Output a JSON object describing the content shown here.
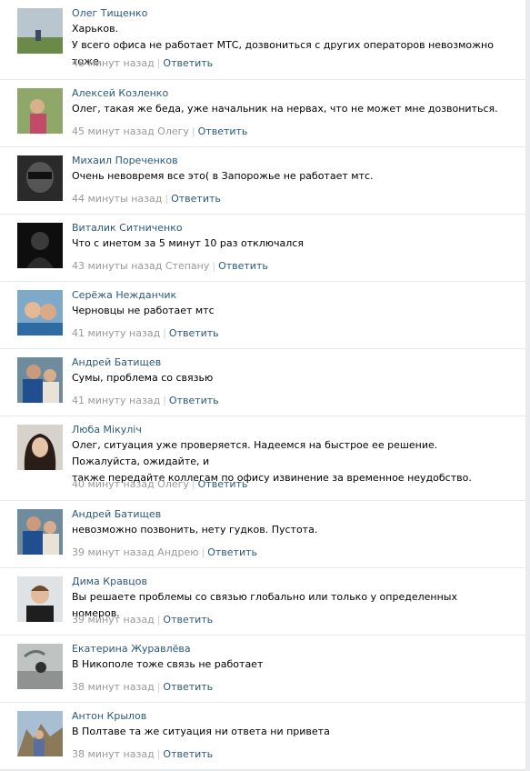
{
  "comments": [
    {
      "author": "Олег Тищенко",
      "lines": [
        "Харьков.",
        "У всего офиса не работает МТС, дозвониться с других операторов невозможно тоже."
      ],
      "time": "48 минут назад",
      "reply": "Ответить"
    },
    {
      "author": "Алексей Козленко",
      "lines": [
        "Олег, такая же беда, уже начальник на нервах, что не может мне дозвониться."
      ],
      "time": "45 минут назад Олегу",
      "reply": "Ответить"
    },
    {
      "author": "Михаил Пореченков",
      "lines": [
        "Очень невовремя все это( в Запорожье не работает мтс."
      ],
      "time": "44 минуты назад",
      "reply": "Ответить"
    },
    {
      "author": "Виталик Ситниченко",
      "lines": [
        "Что с инетом за 5 минут 10 раз отключался"
      ],
      "time": "43 минуты назад Степану",
      "reply": "Ответить"
    },
    {
      "author": "Серёжа Нежданчик",
      "lines": [
        "Черновцы не работает мтс"
      ],
      "time": "41 минуту назад",
      "reply": "Ответить"
    },
    {
      "author": "Андрей Батищев",
      "lines": [
        "Сумы, проблема со связью"
      ],
      "time": "41 минуту назад",
      "reply": "Ответить"
    },
    {
      "author": "Люба Мікуліч",
      "lines": [
        "Олег, ситуация уже проверяется. Надеемся на быстрое ее решение. Пожалуйста, ожидайте, и",
        "также передайте коллегам по офису извинение за временное неудобство."
      ],
      "time": "40 минут назад Олегу",
      "reply": "Ответить"
    },
    {
      "author": "Андрей Батищев",
      "lines": [
        "невозможно позвонить, нету гудков. Пустота."
      ],
      "time": "39 минут назад Андрею",
      "reply": "Ответить"
    },
    {
      "author": "Дима Кравцов",
      "lines": [
        "Вы решаете проблемы со связью глобально или только у определенных номеров."
      ],
      "time": "39 минут назад",
      "reply": "Ответить"
    },
    {
      "author": "Екатерина Журавлёва",
      "lines": [
        "В Никополе тоже связь не работает"
      ],
      "time": "38 минут назад",
      "reply": "Ответить"
    },
    {
      "author": "Антон Крылов",
      "lines": [
        "В Полтаве та же ситуация ни ответа ни привета"
      ],
      "time": "38 минут назад",
      "reply": "Ответить"
    }
  ],
  "colors": {
    "link": "#2b587a",
    "meta": "#999999",
    "divider": "#e7eaed"
  }
}
